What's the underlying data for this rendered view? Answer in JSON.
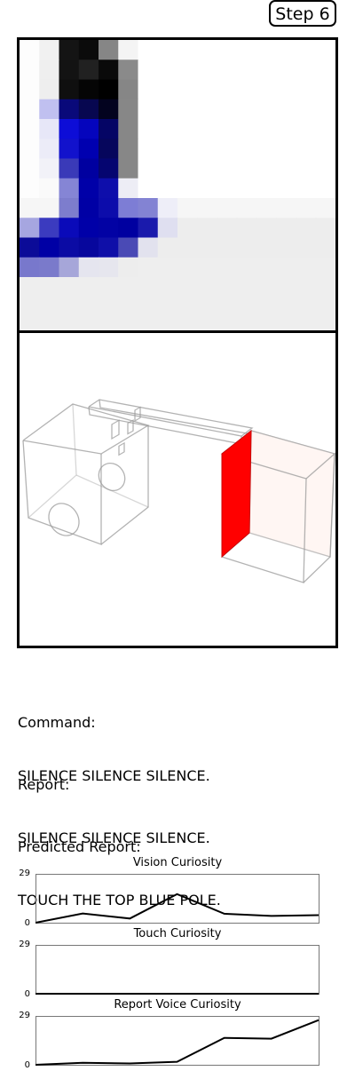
{
  "step_label": "Step 6",
  "vision": {
    "grid": [
      [
        "#fdfdfd",
        "#f1f1f1",
        "#141414",
        "#0b0b0b",
        "#868686",
        "#f4f4f4",
        "#ffffff",
        "#ffffff",
        "#ffffff",
        "#ffffff",
        "#ffffff",
        "#ffffff",
        "#ffffff",
        "#ffffff",
        "#ffffff",
        "#ffffff"
      ],
      [
        "#fdfdfd",
        "#efefef",
        "#131313",
        "#212121",
        "#0a0a0a",
        "#8a8a8a",
        "#ffffff",
        "#ffffff",
        "#ffffff",
        "#ffffff",
        "#ffffff",
        "#ffffff",
        "#ffffff",
        "#ffffff",
        "#ffffff",
        "#ffffff"
      ],
      [
        "#fdfdfd",
        "#eeeeee",
        "#0f0f0f",
        "#050505",
        "#000000",
        "#868686",
        "#ffffff",
        "#ffffff",
        "#ffffff",
        "#ffffff",
        "#ffffff",
        "#ffffff",
        "#ffffff",
        "#ffffff",
        "#ffffff",
        "#ffffff"
      ],
      [
        "#fdfdfd",
        "#c0c0f0",
        "#09097a",
        "#070750",
        "#03031f",
        "#878787",
        "#ffffff",
        "#ffffff",
        "#ffffff",
        "#ffffff",
        "#ffffff",
        "#ffffff",
        "#ffffff",
        "#ffffff",
        "#ffffff",
        "#ffffff"
      ],
      [
        "#fdfdfd",
        "#e7e7f8",
        "#0d0dd7",
        "#0505bd",
        "#050565",
        "#878787",
        "#ffffff",
        "#ffffff",
        "#ffffff",
        "#ffffff",
        "#ffffff",
        "#ffffff",
        "#ffffff",
        "#ffffff",
        "#ffffff",
        "#ffffff"
      ],
      [
        "#fdfdfd",
        "#ececf8",
        "#1212cc",
        "#0000b0",
        "#06065c",
        "#878787",
        "#ffffff",
        "#ffffff",
        "#ffffff",
        "#ffffff",
        "#ffffff",
        "#ffffff",
        "#ffffff",
        "#ffffff",
        "#ffffff",
        "#ffffff"
      ],
      [
        "#fdfdfd",
        "#f2f2f8",
        "#3a3ab8",
        "#0000a0",
        "#050570",
        "#878787",
        "#ffffff",
        "#ffffff",
        "#ffffff",
        "#ffffff",
        "#ffffff",
        "#ffffff",
        "#ffffff",
        "#ffffff",
        "#ffffff",
        "#ffffff"
      ],
      [
        "#fdfdfd",
        "#fafafa",
        "#8585d5",
        "#0000a8",
        "#0e0eab",
        "#ededf5",
        "#ffffff",
        "#ffffff",
        "#ffffff",
        "#ffffff",
        "#ffffff",
        "#ffffff",
        "#ffffff",
        "#ffffff",
        "#ffffff",
        "#ffffff"
      ],
      [
        "#f6f6f6",
        "#f6f6f6",
        "#7d7dcd",
        "#0000a5",
        "#0c0cab",
        "#7d7dd5",
        "#8383d3",
        "#eeeef8",
        "#f6f6f6",
        "#f6f6f6",
        "#f6f6f6",
        "#f6f6f6",
        "#f6f6f6",
        "#f6f6f6",
        "#f6f6f6",
        "#f6f6f6"
      ],
      [
        "#a6a6e0",
        "#3b3bbf",
        "#0a0ab9",
        "#0000a8",
        "#0202a4",
        "#0000a0",
        "#1a1aac",
        "#dfdff0",
        "#ededed",
        "#ededed",
        "#ededed",
        "#ededed",
        "#ededed",
        "#ededed",
        "#ededed",
        "#ededed"
      ],
      [
        "#0b0b98",
        "#0000a5",
        "#0b0ba4",
        "#07079d",
        "#0f0fa8",
        "#4a4ab5",
        "#e2e2ee",
        "#ededed",
        "#ededed",
        "#ededed",
        "#ededed",
        "#ededed",
        "#ededed",
        "#ededed",
        "#ededed",
        "#ededed"
      ],
      [
        "#7878cc",
        "#7a7acb",
        "#a6a6d9",
        "#e5e5ef",
        "#e6e6ee",
        "#ededed",
        "#eeeeee",
        "#eeeeee",
        "#eeeeee",
        "#eeeeee",
        "#eeeeee",
        "#eeeeee",
        "#eeeeee",
        "#eeeeee",
        "#eeeeee",
        "#eeeeee"
      ],
      [
        "#eeeeee",
        "#eeeeee",
        "#eeeeee",
        "#eeeeee",
        "#eeeeee",
        "#eeeeee",
        "#eeeeee",
        "#eeeeee",
        "#eeeeee",
        "#eeeeee",
        "#eeeeee",
        "#eeeeee",
        "#eeeeee",
        "#eeeeee",
        "#eeeeee",
        "#eeeeee"
      ],
      [
        "#eeeeee",
        "#eeeeee",
        "#eeeeee",
        "#eeeeee",
        "#eeeeee",
        "#eeeeee",
        "#eeeeee",
        "#eeeeee",
        "#eeeeee",
        "#eeeeee",
        "#eeeeee",
        "#eeeeee",
        "#eeeeee",
        "#eeeeee",
        "#eeeeee",
        "#eeeeee"
      ],
      [
        "#eeeeee",
        "#eeeeee",
        "#eeeeee",
        "#eeeeee",
        "#eeeeee",
        "#eeeeee",
        "#eeeeee",
        "#eeeeee",
        "#eeeeee",
        "#eeeeee",
        "#eeeeee",
        "#eeeeee",
        "#eeeeee",
        "#eeeeee",
        "#eeeeee",
        "#eeeeee"
      ]
    ]
  },
  "scene": {
    "highlight_color": "#ff0000",
    "wire_color": "#9a9a9a"
  },
  "command": {
    "label": "Command:",
    "text": "SILENCE SILENCE SILENCE."
  },
  "report": {
    "label": "Report:",
    "text": "SILENCE SILENCE SILENCE."
  },
  "predicted": {
    "label": "Predicted Report:",
    "text": "TOUCH THE TOP BLUE POLE."
  },
  "chart_data": [
    {
      "type": "line",
      "title": "Vision Curiosity",
      "ylim": [
        0,
        29
      ],
      "yticks": [
        "29",
        "0"
      ],
      "x": [
        0,
        1,
        2,
        3,
        4,
        5,
        6
      ],
      "values": [
        0,
        5.5,
        2.5,
        17,
        5.3,
        4,
        4.5
      ]
    },
    {
      "type": "line",
      "title": "Touch Curiosity",
      "ylim": [
        0,
        29
      ],
      "yticks": [
        "29",
        "0"
      ],
      "x": [
        0,
        1,
        2,
        3,
        4,
        5,
        6
      ],
      "values": [
        0,
        0,
        0,
        0,
        0,
        0,
        0
      ]
    },
    {
      "type": "line",
      "title": "Report Voice Curiosity",
      "ylim": [
        0,
        29
      ],
      "yticks": [
        "29",
        "0"
      ],
      "x": [
        0,
        1,
        2,
        3,
        4,
        5,
        6
      ],
      "values": [
        0,
        1.2,
        0.8,
        1.8,
        16,
        15.5,
        26.5
      ]
    }
  ]
}
